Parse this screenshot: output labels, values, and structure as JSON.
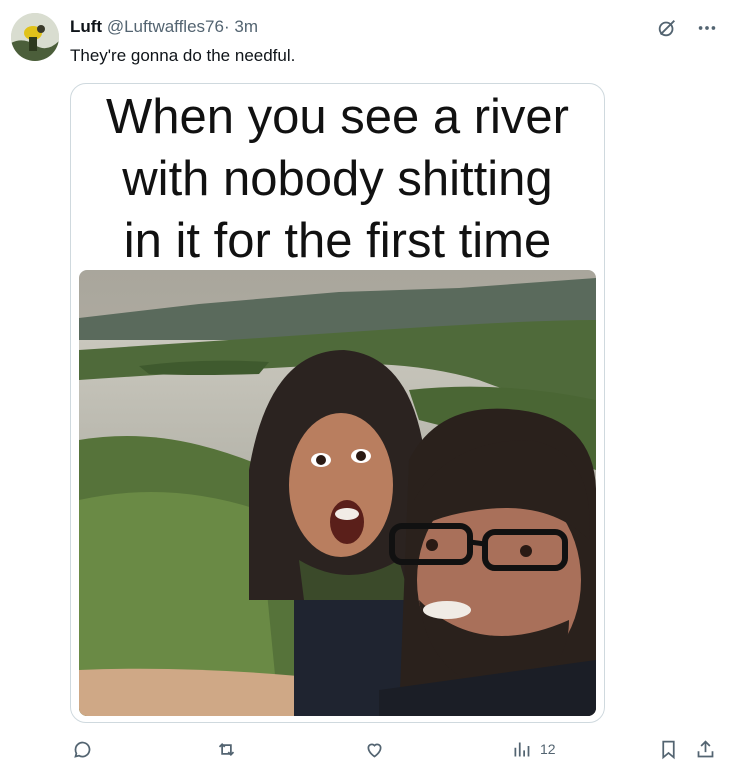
{
  "tweet": {
    "display_name": "Luft",
    "handle": "@Luftwaffles76",
    "separator": "·",
    "time": "3m",
    "text": "They're gonna do the needful."
  },
  "media": {
    "caption_lines": [
      "When you see a river",
      "with nobody shitting",
      "in it for the first time"
    ]
  },
  "actions": {
    "views_count": "12"
  },
  "icons": {
    "top": [
      "grok-icon",
      "more-icon"
    ],
    "bottom": [
      "reply-icon",
      "retweet-icon",
      "like-icon",
      "views-icon",
      "bookmark-icon",
      "share-icon"
    ]
  },
  "colors": {
    "text": "#0f1419",
    "muted": "#536471",
    "border": "#cfd9de"
  }
}
